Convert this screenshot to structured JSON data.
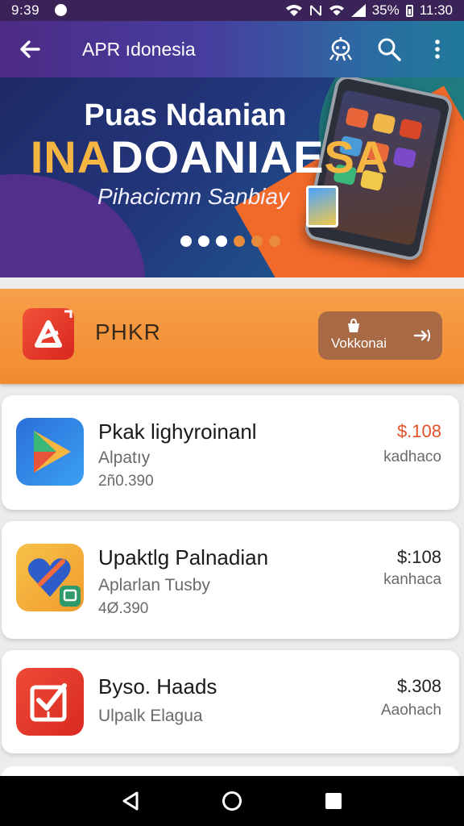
{
  "status_bar": {
    "time": "9:39",
    "battery": "35%",
    "clock": "11:30"
  },
  "app_bar": {
    "title": "APR ıdonesia",
    "icons": [
      "back-arrow-icon",
      "alien-icon",
      "search-icon",
      "more-vert-icon"
    ]
  },
  "banner": {
    "line1": "Puas Ndanian",
    "line2_a": "INA",
    "line2_b": "DOANIAE",
    "line2_c": "SA",
    "line3": "Pihacicmn Sanbiay",
    "dots": [
      {
        "color": "#ffffff",
        "active": true
      },
      {
        "color": "#ffffff",
        "active": false
      },
      {
        "color": "#ffffff",
        "active": false
      },
      {
        "color": "#e88b3a",
        "active": false
      },
      {
        "color": "#e88b3a",
        "active": false
      },
      {
        "color": "#e88b3a",
        "active": false
      }
    ]
  },
  "promo": {
    "name": "PHKR",
    "button": "Vokkonai",
    "colors": {
      "bg": "#f28a2e",
      "button": "#a86a44"
    }
  },
  "apps": [
    {
      "title": "Pkak lighyroinanl",
      "subtitle": "Alpatıy",
      "count": "2ñ0.390",
      "price": "$.108",
      "price_color": "#e0522a",
      "note": "kadhaco"
    },
    {
      "title": "Upaktlg Palnadian",
      "subtitle": "Aplarlan Tusby",
      "count": "4Ø.390",
      "price": "$:108",
      "price_color": "#222222",
      "note": "kanhaca"
    },
    {
      "title": "Byso. Haads",
      "subtitle": "Ulpalk Elagua",
      "count": "",
      "price": "$.308",
      "price_color": "#222222",
      "note": "Aaohach"
    }
  ],
  "nav": {
    "icons": [
      "back-triangle-icon",
      "home-circle-icon",
      "recents-square-icon"
    ]
  }
}
